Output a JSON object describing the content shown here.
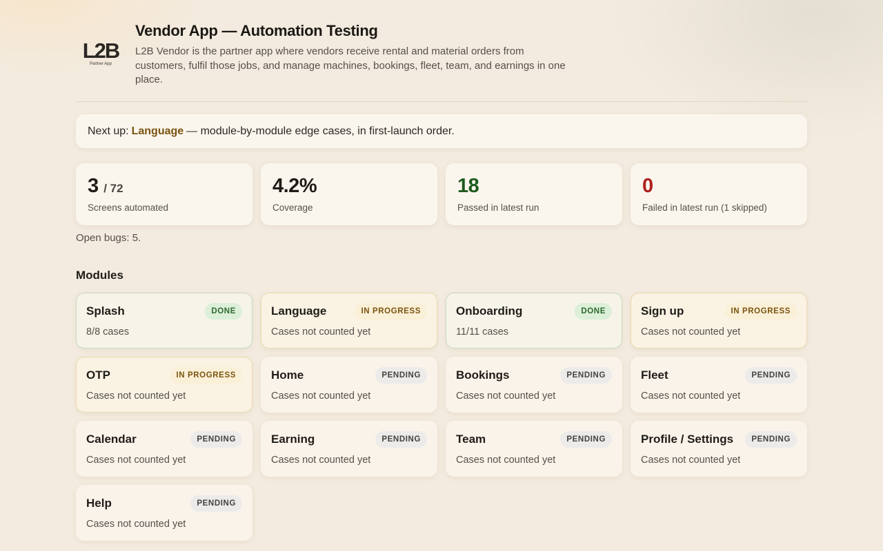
{
  "header": {
    "logo_text": "L2B",
    "logo_subtext": "Partner App",
    "title": "Vendor App — Automation Testing",
    "description": "L2B Vendor is the partner app where vendors receive rental and material orders from customers, fulfil those jobs, and manage machines, bookings, fleet, team, and earnings in one place."
  },
  "next_up": {
    "prefix": "Next up:",
    "module": "Language",
    "suffix": "— module-by-module edge cases, in first-launch order."
  },
  "stats": {
    "screens": {
      "value": "3",
      "total": "/ 72",
      "label": "Screens automated"
    },
    "coverage": {
      "value": "4.2%",
      "label": "Coverage"
    },
    "passed": {
      "value": "18",
      "label": "Passed in latest run",
      "color": "#1e5a1e"
    },
    "failed": {
      "value": "0",
      "label": "Failed in latest run (1 skipped)",
      "color": "#b01e1e"
    }
  },
  "bugs": "Open bugs: 5.",
  "modules_title": "Modules",
  "modules": [
    {
      "name": "Splash",
      "status": "DONE",
      "cases": "8/8 cases"
    },
    {
      "name": "Language",
      "status": "IN PROGRESS",
      "cases": "Cases not counted yet"
    },
    {
      "name": "Onboarding",
      "status": "DONE",
      "cases": "11/11 cases"
    },
    {
      "name": "Sign up",
      "status": "IN PROGRESS",
      "cases": "Cases not counted yet"
    },
    {
      "name": "OTP",
      "status": "IN PROGRESS",
      "cases": "Cases not counted yet"
    },
    {
      "name": "Home",
      "status": "PENDING",
      "cases": "Cases not counted yet"
    },
    {
      "name": "Bookings",
      "status": "PENDING",
      "cases": "Cases not counted yet"
    },
    {
      "name": "Fleet",
      "status": "PENDING",
      "cases": "Cases not counted yet"
    },
    {
      "name": "Calendar",
      "status": "PENDING",
      "cases": "Cases not counted yet"
    },
    {
      "name": "Earning",
      "status": "PENDING",
      "cases": "Cases not counted yet"
    },
    {
      "name": "Team",
      "status": "PENDING",
      "cases": "Cases not counted yet"
    },
    {
      "name": "Profile / Settings",
      "status": "PENDING",
      "cases": "Cases not counted yet"
    },
    {
      "name": "Help",
      "status": "PENDING",
      "cases": "Cases not counted yet"
    }
  ],
  "colors": {
    "background": "#f3ebdf",
    "card": "#faf6ee",
    "accent_next": "#7a5410",
    "done_badge": "#dcefd8",
    "progress_badge": "#faf0d8",
    "pending_badge": "#ecebea"
  }
}
